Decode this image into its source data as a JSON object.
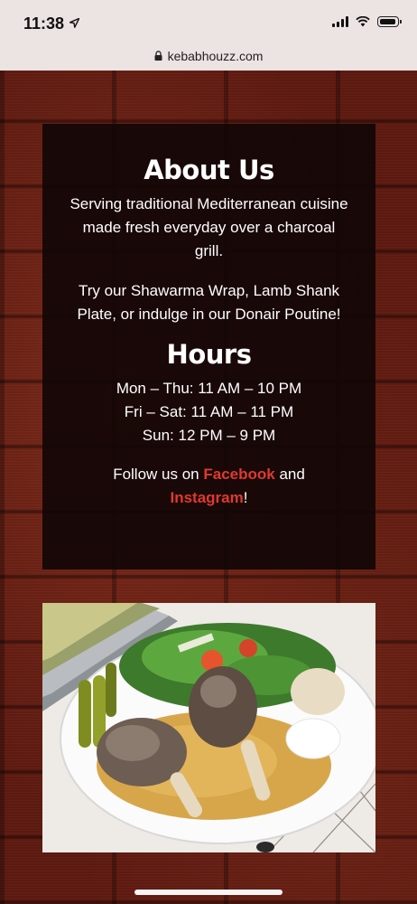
{
  "status_bar": {
    "time": "11:38",
    "icons": [
      "location-arrow-icon",
      "cellular-signal-icon",
      "wifi-icon",
      "battery-icon"
    ]
  },
  "browser": {
    "url": "kebabhouzz.com",
    "lock_icon": "lock-icon"
  },
  "about": {
    "title": "About Us",
    "paragraph1": "Serving traditional Mediterranean cuisine made fresh everyday over a charcoal grill.",
    "paragraph2": "Try our Shawarma Wrap, Lamb Shank Plate, or indulge in our Donair Poutine!"
  },
  "hours": {
    "title": "Hours",
    "lines": [
      "Mon – Thu: 11 AM – 10 PM",
      "Fri – Sat: 11 AM – 11 PM",
      "Sun: 12 PM – 9 PM"
    ]
  },
  "follow": {
    "prefix": "Follow us on ",
    "facebook": "Facebook",
    "middle": " and",
    "instagram": "Instagram",
    "suffix": "!"
  },
  "photo": {
    "subject": "lamb-shank-plate-photo"
  },
  "colors": {
    "link": "#e0392f",
    "panel_bg": "#120606",
    "wall": "#5c1910"
  }
}
